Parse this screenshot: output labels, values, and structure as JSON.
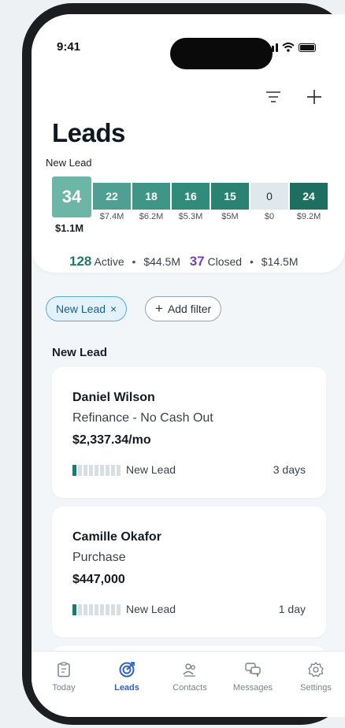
{
  "status": {
    "time": "9:41"
  },
  "header": {
    "title": "Leads",
    "stage_label": "New Lead"
  },
  "stages": [
    {
      "count": "34",
      "amount": "$1.1M",
      "color": "#6db5a6"
    },
    {
      "count": "22",
      "amount": "$7.4M",
      "color": "#4fa092"
    },
    {
      "count": "18",
      "amount": "$6.2M",
      "color": "#3f9686"
    },
    {
      "count": "16",
      "amount": "$5.3M",
      "color": "#318b7b"
    },
    {
      "count": "15",
      "amount": "$5M",
      "color": "#2a8272"
    },
    {
      "count": "0",
      "amount": "$0",
      "color": "#dfe8ea"
    },
    {
      "count": "24",
      "amount": "$9.2M",
      "color": "#1e6f60"
    }
  ],
  "summary": {
    "active_count": "128",
    "active_label": "Active",
    "active_amount": "$44.5M",
    "closed_count": "37",
    "closed_label": "Closed",
    "closed_amount": "$14.5M",
    "separator": "•",
    "active_color": "#1e7a6a",
    "closed_color": "#7b3fb5"
  },
  "filters": {
    "active_chip": "New Lead",
    "active_chip_close": "×",
    "add_filter": "Add filter",
    "add_icon": "+"
  },
  "section": {
    "label": "New Lead"
  },
  "leads": [
    {
      "name": "Daniel Wilson",
      "type": "Refinance - No Cash Out",
      "amount": "$2,337.34/mo",
      "stage": "New Lead",
      "age": "3 days",
      "progress": 0.1
    },
    {
      "name": "Camille Okafor",
      "type": "Purchase",
      "amount": "$447,000",
      "stage": "New Lead",
      "age": "1 day",
      "progress": 0.1
    }
  ],
  "tabs": [
    {
      "label": "Today",
      "icon": "clipboard-icon"
    },
    {
      "label": "Leads",
      "icon": "target-icon"
    },
    {
      "label": "Contacts",
      "icon": "contacts-icon"
    },
    {
      "label": "Messages",
      "icon": "messages-icon"
    },
    {
      "label": "Settings",
      "icon": "gear-icon"
    }
  ],
  "active_tab": "Leads",
  "colors": {
    "accent": "#2f62c9",
    "teal": "#1e7a6a"
  }
}
